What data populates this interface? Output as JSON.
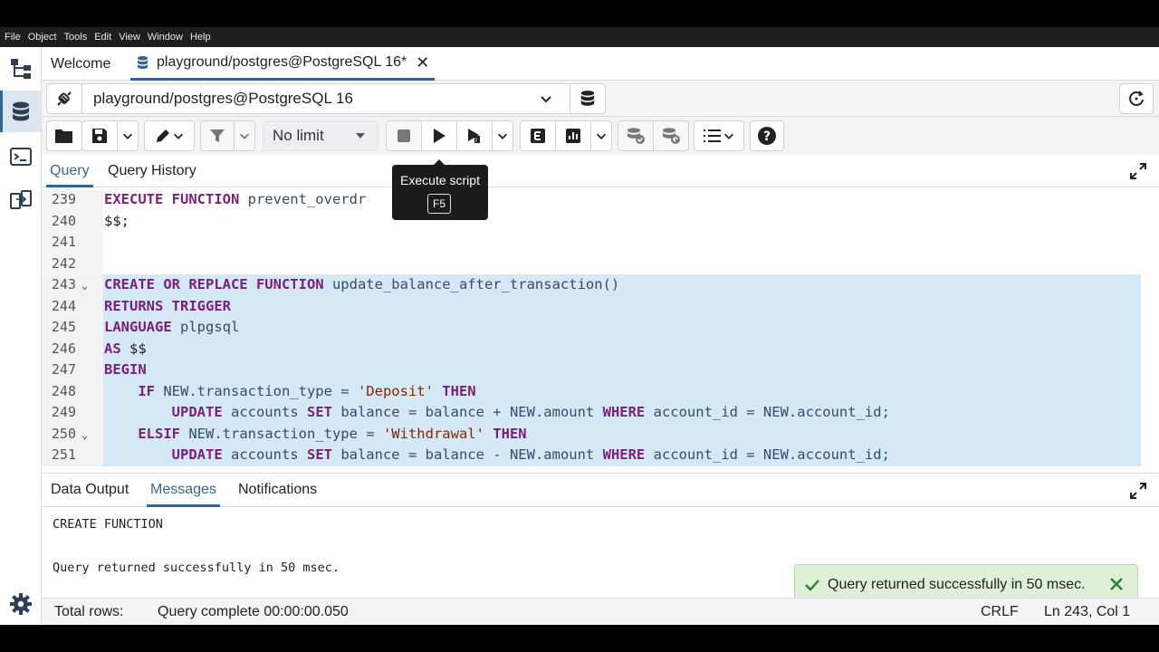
{
  "menubar": [
    "File",
    "Object",
    "Tools",
    "Edit",
    "View",
    "Window",
    "Help"
  ],
  "tabs": {
    "welcome": "Welcome",
    "query": "playground/postgres@PostgreSQL 16*",
    "close": "✕"
  },
  "connection": {
    "value": "playground/postgres@PostgreSQL 16"
  },
  "toolbar": {
    "limit": "No limit"
  },
  "query_tabs": {
    "query": "Query",
    "history": "Query History"
  },
  "tooltip": {
    "title": "Execute script",
    "shortcut": "F5"
  },
  "editor": {
    "lines": [
      {
        "n": "239",
        "fold": "",
        "selected": false,
        "tokens": [
          [
            "kw",
            "EXECUTE FUNCTION "
          ],
          [
            "fn",
            "prevent_overdr"
          ]
        ]
      },
      {
        "n": "240",
        "fold": "",
        "selected": false,
        "tokens": [
          [
            "",
            "$$;"
          ]
        ]
      },
      {
        "n": "241",
        "fold": "",
        "selected": false,
        "tokens": []
      },
      {
        "n": "242",
        "fold": "",
        "selected": false,
        "tokens": []
      },
      {
        "n": "243",
        "fold": "⌄",
        "selected": true,
        "tokens": [
          [
            "kw",
            "CREATE OR REPLACE FUNCTION "
          ],
          [
            "fn",
            "update_balance_after_transaction()"
          ]
        ]
      },
      {
        "n": "244",
        "fold": "",
        "selected": true,
        "tokens": [
          [
            "kw",
            "RETURNS TRIGGER"
          ]
        ]
      },
      {
        "n": "245",
        "fold": "",
        "selected": true,
        "tokens": [
          [
            "kw",
            "LANGUAGE "
          ],
          [
            "fn",
            "plpgsql"
          ]
        ]
      },
      {
        "n": "246",
        "fold": "",
        "selected": true,
        "tokens": [
          [
            "kw",
            "AS "
          ],
          [
            "",
            "$$"
          ]
        ]
      },
      {
        "n": "247",
        "fold": "",
        "selected": true,
        "tokens": [
          [
            "kw",
            "BEGIN"
          ]
        ]
      },
      {
        "n": "248",
        "fold": "",
        "selected": true,
        "tokens": [
          [
            "",
            "    "
          ],
          [
            "kw",
            "IF "
          ],
          [
            "fn",
            "NEW.transaction_type = "
          ],
          [
            "str",
            "'Deposit'"
          ],
          [
            "kw",
            " THEN"
          ]
        ]
      },
      {
        "n": "249",
        "fold": "",
        "selected": true,
        "tokens": [
          [
            "",
            "        "
          ],
          [
            "kw",
            "UPDATE "
          ],
          [
            "fn",
            "accounts "
          ],
          [
            "kw",
            "SET "
          ],
          [
            "fn",
            "balance = balance + NEW.amount "
          ],
          [
            "kw",
            "WHERE "
          ],
          [
            "fn",
            "account_id = NEW.account_id;"
          ]
        ]
      },
      {
        "n": "250",
        "fold": "⌄",
        "selected": true,
        "tokens": [
          [
            "",
            "    "
          ],
          [
            "kw",
            "ELSIF "
          ],
          [
            "fn",
            "NEW.transaction_type = "
          ],
          [
            "str",
            "'Withdrawal'"
          ],
          [
            "kw",
            " THEN"
          ]
        ]
      },
      {
        "n": "251",
        "fold": "",
        "selected": true,
        "tokens": [
          [
            "",
            "        "
          ],
          [
            "kw",
            "UPDATE "
          ],
          [
            "fn",
            "accounts "
          ],
          [
            "kw",
            "SET "
          ],
          [
            "fn",
            "balance = balance - NEW.amount "
          ],
          [
            "kw",
            "WHERE "
          ],
          [
            "fn",
            "account_id = NEW.account_id;"
          ]
        ]
      }
    ]
  },
  "result_tabs": {
    "data_output": "Data Output",
    "messages": "Messages",
    "notifications": "Notifications"
  },
  "messages": {
    "line1": "CREATE FUNCTION",
    "line2": "Query returned successfully in 50 msec."
  },
  "toast": {
    "text": "Query returned successfully in 50 msec."
  },
  "status": {
    "total_rows": "Total rows:",
    "query_complete": "Query complete 00:00:00.050",
    "line_ending": "CRLF",
    "cursor": "Ln 243, Col 1"
  },
  "colors": {
    "accent": "#326690",
    "selection": "#d4e8f5",
    "keyword": "#7a1f7a",
    "string": "#8b2500",
    "toast_bg": "#dff0d8",
    "toast_check": "#2e7d32"
  }
}
